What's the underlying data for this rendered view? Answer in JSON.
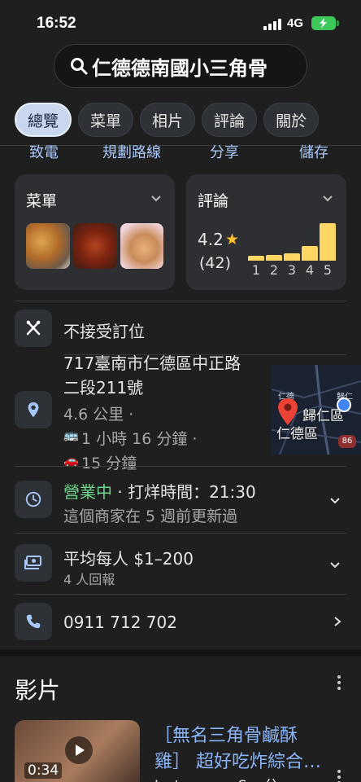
{
  "status_bar": {
    "time": "16:52",
    "network": "4G"
  },
  "search": {
    "query": "仁德德南國小三角骨"
  },
  "tabs": [
    {
      "label": "總覽",
      "active": true
    },
    {
      "label": "菜單",
      "active": false
    },
    {
      "label": "相片",
      "active": false
    },
    {
      "label": "評論",
      "active": false
    },
    {
      "label": "關於",
      "active": false
    }
  ],
  "quick_actions": [
    "致電",
    "規劃路線",
    "分享",
    "儲存"
  ],
  "menu_card": {
    "title": "菜單"
  },
  "reviews_card": {
    "title": "評論",
    "rating": "4.2",
    "count": "(42)",
    "distribution": [
      {
        "stars": "1",
        "fraction": 0.13
      },
      {
        "stars": "2",
        "fraction": 0.15
      },
      {
        "stars": "3",
        "fraction": 0.2
      },
      {
        "stars": "4",
        "fraction": 0.4
      },
      {
        "stars": "5",
        "fraction": 1.0
      }
    ]
  },
  "reservation": {
    "text": "不接受訂位"
  },
  "address": {
    "line1": "717臺南市仁德區中正路",
    "line2": "二段211號",
    "distance": "4.6 公里 ·",
    "transit": "1 小時 16 分鐘 ·",
    "drive": "15 分鐘"
  },
  "map": {
    "label_main": "歸仁區",
    "label_district": "仁德區",
    "label_small1": "仁德",
    "label_small2": "歸仁",
    "road": "86"
  },
  "hours": {
    "status": "營業中",
    "rest": " · 打烊時間：21:30",
    "note": "這個商家在 5 週前更新過"
  },
  "price": {
    "text": "平均每人 $1–200",
    "reports": "4 人回報"
  },
  "phone": {
    "number": "0911 712 702"
  },
  "videos": {
    "title": "影片",
    "items": [
      {
        "duration": "0:34",
        "title_line1": "［無名三角骨鹹酥",
        "title_line2": "雞］ 超好吃炸綜合…",
        "source": "Instagram · Sun分"
      }
    ]
  },
  "colors": {
    "accent": "#8ab4f8",
    "open_green": "#6dd58c",
    "star_yellow": "#fbc02d",
    "background": "#1f1f1f"
  }
}
